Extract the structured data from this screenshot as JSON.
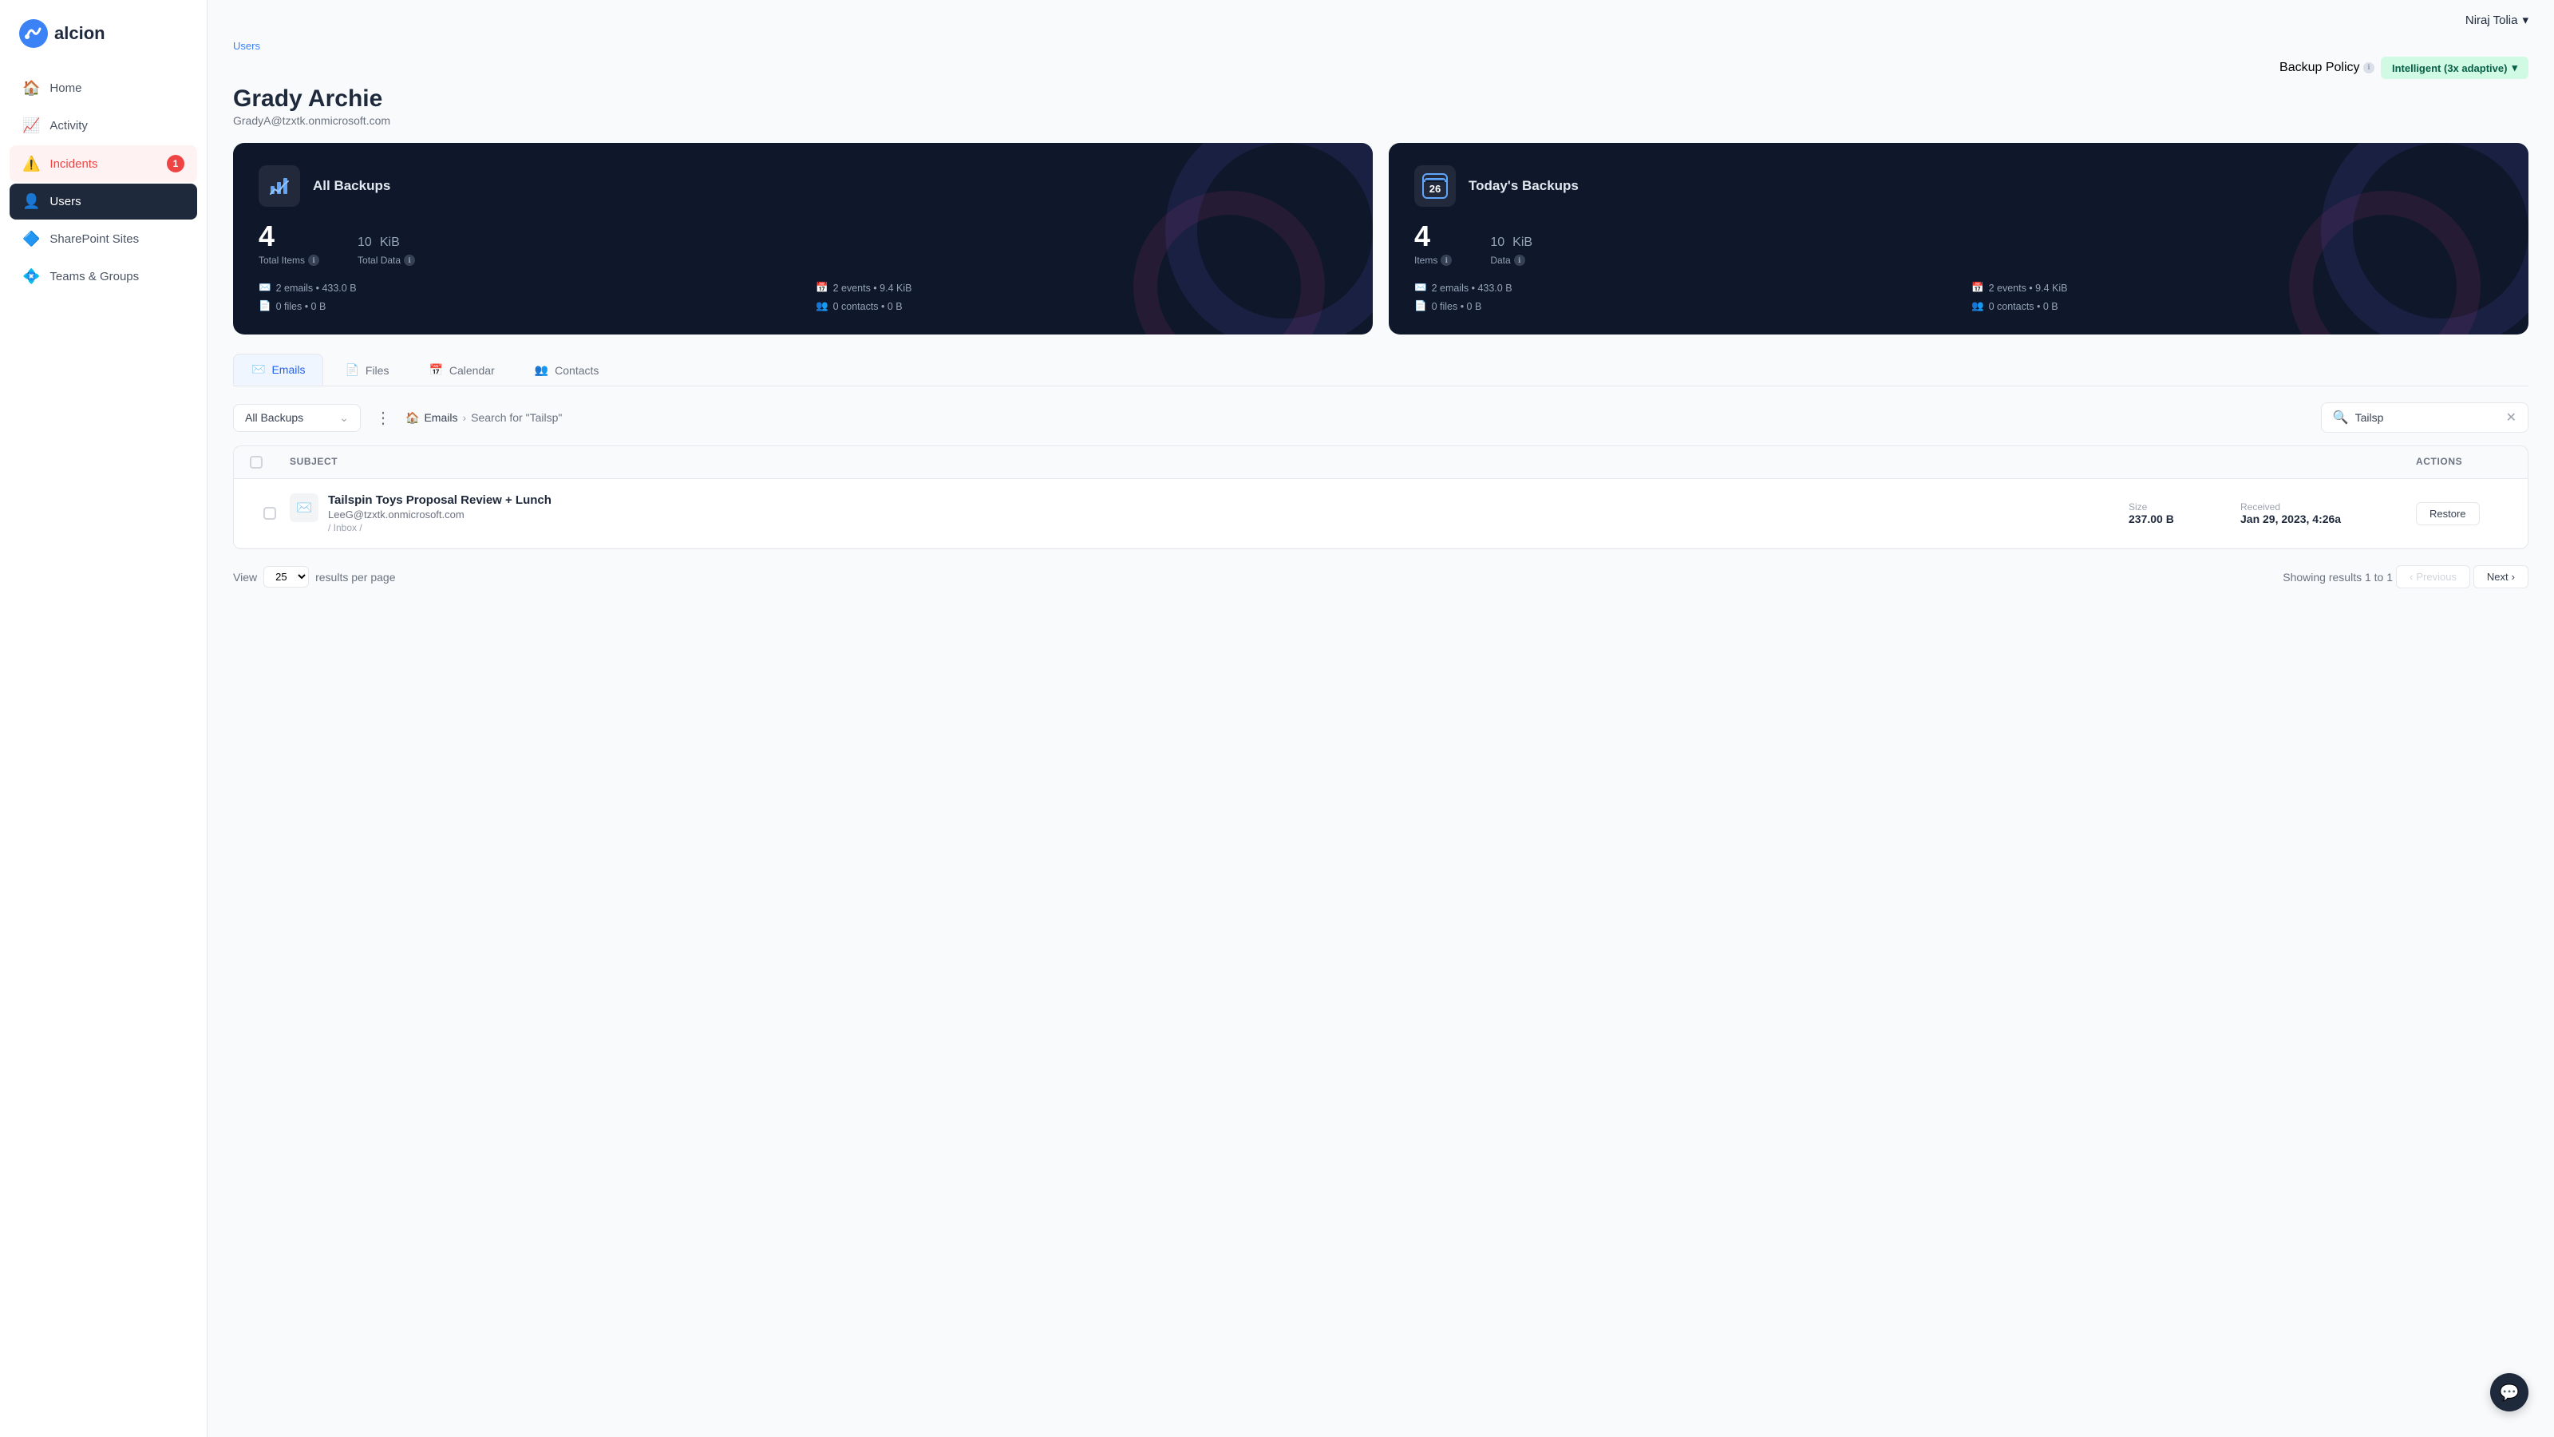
{
  "app": {
    "name": "alcion"
  },
  "user": {
    "name": "Niraj Tolia"
  },
  "sidebar": {
    "items": [
      {
        "id": "home",
        "label": "Home",
        "icon": "🏠",
        "active": false
      },
      {
        "id": "activity",
        "label": "Activity",
        "icon": "📈",
        "active": false
      },
      {
        "id": "incidents",
        "label": "Incidents",
        "icon": "⚠️",
        "active": false,
        "badge": "1"
      },
      {
        "id": "users",
        "label": "Users",
        "icon": "👤",
        "active": true
      },
      {
        "id": "sharepoint",
        "label": "SharePoint Sites",
        "icon": "🔷",
        "active": false
      },
      {
        "id": "teams",
        "label": "Teams & Groups",
        "icon": "💠",
        "active": false
      }
    ]
  },
  "breadcrumb": "Users",
  "page_title": "Grady Archie",
  "page_subtitle": "GradyA@tzxtk.onmicrosoft.com",
  "backup_policy_label": "Backup Policy",
  "backup_policy_value": "Intelligent (3x adaptive)",
  "all_backups_card": {
    "title": "All Backups",
    "total_items_label": "Total Items",
    "total_items_value": "4",
    "total_data_label": "Total Data",
    "total_data_value": "10",
    "total_data_unit": "KiB",
    "details": [
      {
        "icon": "✉️",
        "text": "2 emails • 433.0 B"
      },
      {
        "icon": "📅",
        "text": "2 events • 9.4 KiB"
      },
      {
        "icon": "📄",
        "text": "0 files • 0 B"
      },
      {
        "icon": "👥",
        "text": "0 contacts • 0 B"
      }
    ]
  },
  "todays_backups_card": {
    "title": "Today's Backups",
    "day": "26",
    "items_label": "Items",
    "items_value": "4",
    "data_label": "Data",
    "data_value": "10",
    "data_unit": "KiB",
    "details": [
      {
        "icon": "✉️",
        "text": "2 emails • 433.0 B"
      },
      {
        "icon": "📅",
        "text": "2 events • 9.4 KiB"
      },
      {
        "icon": "📄",
        "text": "0 files • 0 B"
      },
      {
        "icon": "👥",
        "text": "0 contacts • 0 B"
      }
    ]
  },
  "tabs": [
    {
      "id": "emails",
      "label": "Emails",
      "icon": "✉️",
      "active": true
    },
    {
      "id": "files",
      "label": "Files",
      "icon": "📄",
      "active": false
    },
    {
      "id": "calendar",
      "label": "Calendar",
      "icon": "📅",
      "active": false
    },
    {
      "id": "contacts",
      "label": "Contacts",
      "icon": "👥",
      "active": false
    }
  ],
  "filter": {
    "backup_select": "All Backups",
    "path_icon": "🏠",
    "path_root": "Emails",
    "path_search": "Search for \"Tailsp\"",
    "search_value": "Tailsp"
  },
  "table": {
    "columns": [
      {
        "id": "subject",
        "label": "SUBJECT"
      },
      {
        "id": "size",
        "label": ""
      },
      {
        "id": "received",
        "label": ""
      },
      {
        "id": "actions",
        "label": "ACTIONS"
      }
    ],
    "rows": [
      {
        "subject": "Tailspin Toys Proposal Review + Lunch",
        "from": "LeeG@tzxtk.onmicrosoft.com",
        "folder": "/ Inbox /",
        "size_label": "Size",
        "size_value": "237.00 B",
        "received_label": "Received",
        "received_value": "Jan 29, 2023, 4:26a",
        "action": "Restore"
      }
    ]
  },
  "pagination": {
    "view_label": "View",
    "per_page": "25",
    "results_label": "results per page",
    "showing": "Showing results 1 to 1",
    "previous": "Previous",
    "next": "Next"
  }
}
